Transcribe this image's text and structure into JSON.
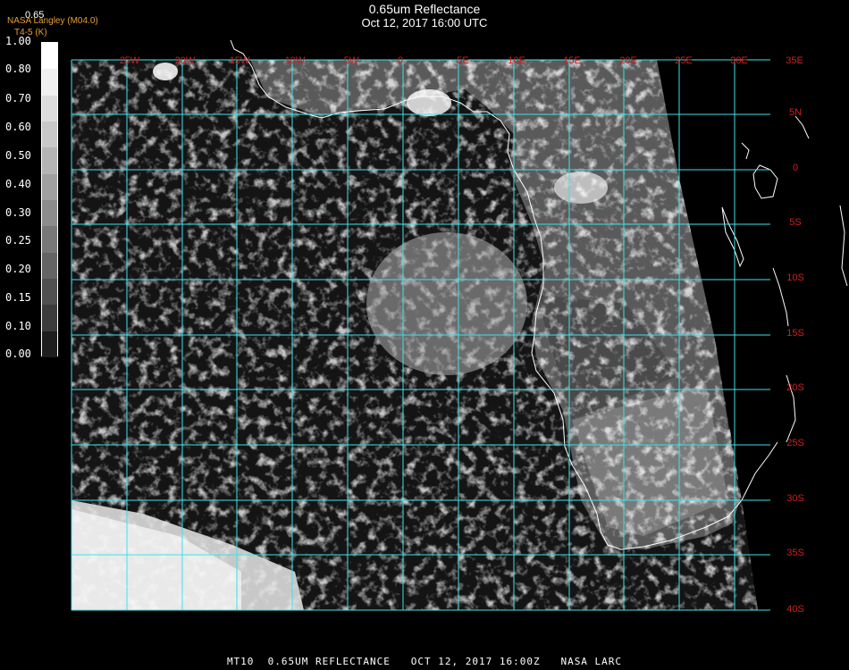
{
  "header": {
    "title": "0.65um Reflectance",
    "subtitle": "Oct 12, 2017 16:00 UTC",
    "overlay_value": "0.65",
    "source_label": "NASA Langley (M04.0)",
    "unit_label": "T4-5 (K)"
  },
  "colorbar": {
    "ticks": [
      "1.00",
      "0.80",
      "0.70",
      "0.60",
      "0.50",
      "0.40",
      "0.30",
      "0.25",
      "0.20",
      "0.15",
      "0.10",
      "0.00"
    ],
    "colors": [
      "#ffffff",
      "#f0f0f0",
      "#dcdcdc",
      "#c8c8c8",
      "#b4b4b4",
      "#a0a0a0",
      "#8c8c8c",
      "#787878",
      "#646464",
      "#505050",
      "#3c3c3c",
      "#1e1e1e"
    ]
  },
  "map": {
    "longitude_labels": [
      "25W",
      "20W",
      "15W",
      "10W",
      "5W",
      "0",
      "5E",
      "10E",
      "15E",
      "20E",
      "25E",
      "30E",
      "35E"
    ],
    "latitude_labels": [
      "5N",
      "0",
      "5S",
      "10S",
      "15S",
      "20S",
      "25S",
      "30S",
      "35S",
      "40S"
    ],
    "grid_color": "#40e0e8",
    "label_color": "#cc2020"
  },
  "footer": {
    "text": "MT10  0.65UM REFLECTANCE   OCT 12, 2017 16:00Z   NASA LARC"
  }
}
